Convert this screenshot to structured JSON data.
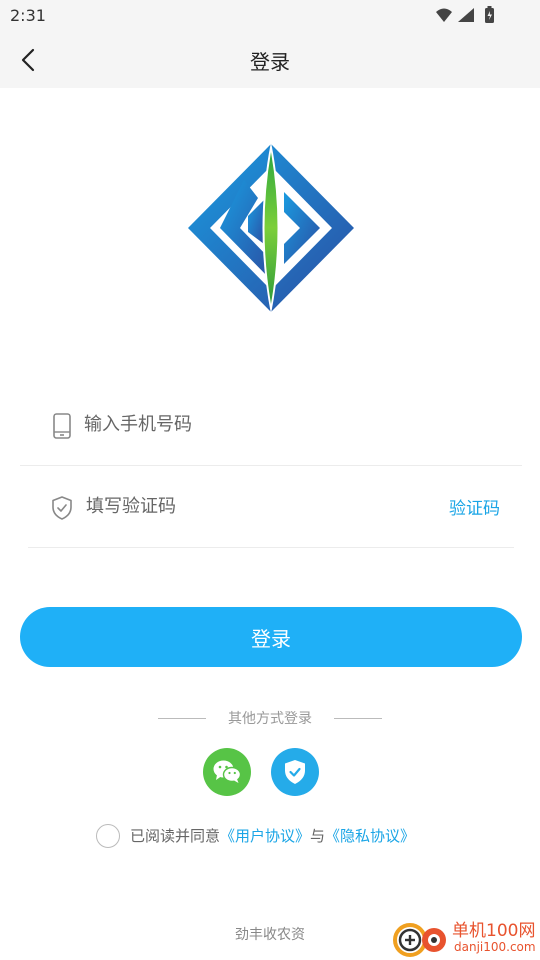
{
  "status": {
    "time": "2:31"
  },
  "header": {
    "title": "登录"
  },
  "form": {
    "phone_placeholder": "输入手机号码",
    "code_placeholder": "填写验证码",
    "get_code_label": "验证码"
  },
  "login_button": "登录",
  "other_login": {
    "label": "其他方式登录",
    "options": [
      "wechat-icon",
      "shield-check-icon"
    ]
  },
  "agreement": {
    "prefix": "已阅读并同意",
    "user_agreement": "《用户协议》",
    "conjunction": "与",
    "privacy_policy": "《隐私协议》"
  },
  "footer": {
    "brand": "劲丰收农资"
  },
  "watermark": {
    "line1": "单机100网",
    "line2": "danji100.com"
  },
  "colors": {
    "primary": "#1fb0f7",
    "link": "#1aa5e6",
    "wechat": "#57c446",
    "logo_blue": "#1f7fd0",
    "logo_green": "#5cb63a"
  }
}
